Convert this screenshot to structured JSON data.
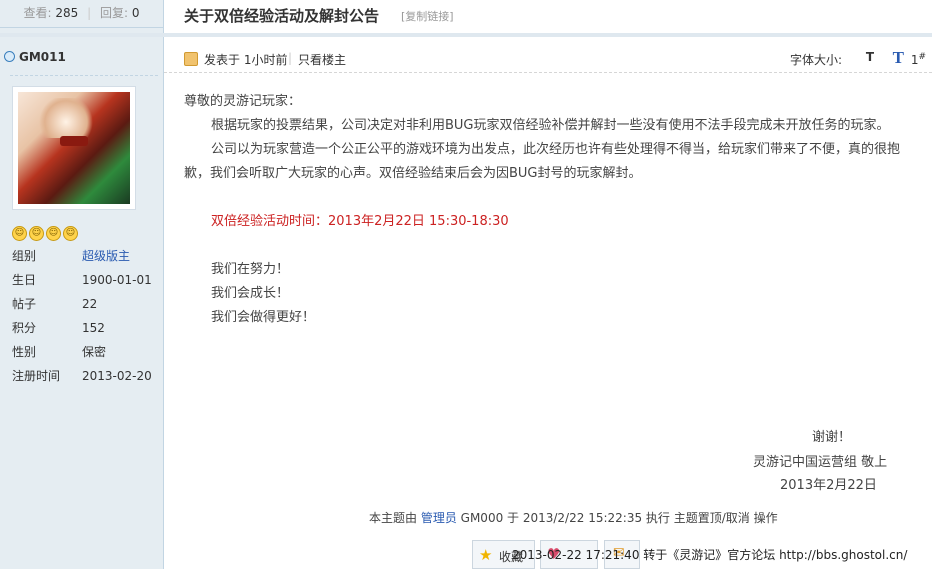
{
  "stats": {
    "views_label": "查看:",
    "views": "285",
    "sep": "|",
    "replies_label": "回复:",
    "replies": "0"
  },
  "thread": {
    "title": "关于双倍经验活动及解封公告",
    "copy_link": "[复制链接]"
  },
  "user": {
    "name": "GM011",
    "info": [
      {
        "k": "组别",
        "v": "超级版主"
      },
      {
        "k": "生日",
        "v": "1900-01-01"
      },
      {
        "k": "帖子",
        "v": "22"
      },
      {
        "k": "积分",
        "v": "152"
      },
      {
        "k": "性别",
        "v": "保密"
      },
      {
        "k": "注册时间",
        "v": "2013-02-20"
      }
    ]
  },
  "post_head": {
    "posted": "发表于 1小时前",
    "sep": "|",
    "only_op": "只看楼主",
    "font_size_label": "字体大小:",
    "font_small": "T",
    "font_big": "T",
    "floor": "1",
    "floor_sup": "#"
  },
  "content": {
    "greeting": "尊敬的灵游记玩家：",
    "p1": "根据玩家的投票结果，公司决定对非利用BUG玩家双倍经验补偿并解封一些没有使用不法手段完成未开放任务的玩家。",
    "p2": "公司以为玩家营造一个公正公平的游戏环境为出发点，此次经历也许有些处理得不得当，给玩家们带来了不便，真的很抱歉，我们会听取广大玩家的心声。双倍经验结束后会为因BUG封号的玩家解封。",
    "event": "双倍经验活动时间：2013年2月22日 15:30-18:30",
    "l1": "我们在努力！",
    "l2": "我们会成长！",
    "l3": "我们会做得更好！"
  },
  "signature": {
    "thanks": "谢谢！",
    "org": "灵游记中国运营组 敬上",
    "date": "2013年2月22日"
  },
  "footer": {
    "pre": "本主题由 ",
    "admin": "管理员",
    "post": " GM000 于 2013/2/22 15:22:35 执行 主题置顶/取消 操作"
  },
  "buttons": {
    "fav": "收藏"
  },
  "overlay_text": "2013-02-22 17:21:40 转于《灵游记》官方论坛 http://bbs.ghostol.cn/"
}
